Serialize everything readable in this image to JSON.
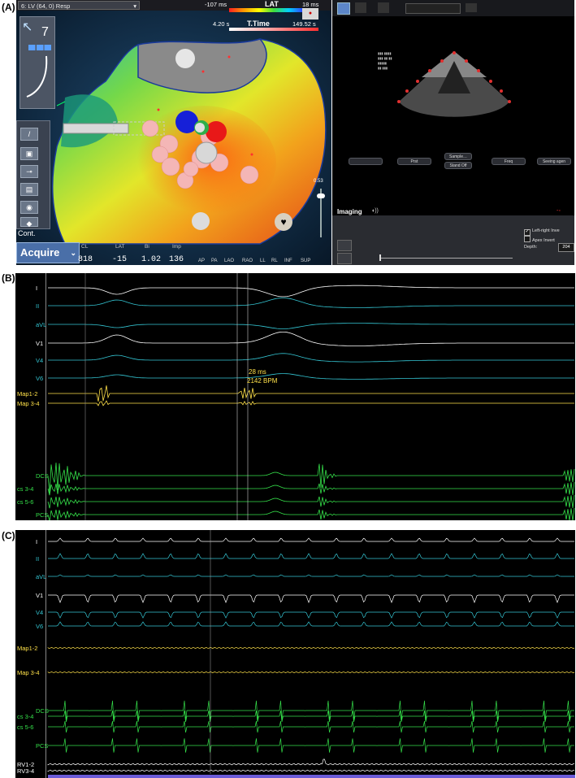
{
  "panels": {
    "a": "(A)",
    "b": "(B)",
    "c": "(C)"
  },
  "map": {
    "catheter_selector": "6: LV (64, 0) Resp",
    "lat_title": "LAT",
    "lat_min": "-107 ms",
    "lat_max": "18 ms",
    "tt_title": "T.Time",
    "tt_min": "4.20 s",
    "tt_max": "149.52 s",
    "tool_number": "7",
    "scale_value": "0.53",
    "cont_label": "Cont.",
    "acquire_label": "Acquire",
    "stat_labels": [
      "CL",
      "LAT",
      "Bi",
      "Imp"
    ],
    "stat_values": [
      "818",
      "-15",
      "1.02",
      "136"
    ],
    "view_buttons": [
      "AP",
      "PA",
      "LAO",
      "RAO",
      "LL",
      "RL",
      "INF",
      "SUP"
    ]
  },
  "imaging": {
    "title": "Imaging",
    "buttons": [
      "",
      "Prst",
      "Sample…",
      "Freq",
      "Seeing agen"
    ],
    "button_sub": "Stand Off",
    "options": [
      "Left-right Inve",
      "Apex Invert"
    ],
    "depth_label": "Depth:",
    "depth_value": "204"
  },
  "panel_b": {
    "leads": [
      "I",
      "II",
      "aVL",
      "V1",
      "V4",
      "V6",
      "Map1-2",
      "Map 3-4",
      "DCS",
      "cs 3-4",
      "cs 5-6",
      "PCS"
    ],
    "lead_colors": [
      "#ffffff",
      "#34c6d4",
      "#34c6d4",
      "#ffffff",
      "#34c6d4",
      "#34c6d4",
      "#ffe14a",
      "#ffe14a",
      "#35e04a",
      "#35e04a",
      "#35e04a",
      "#35e04a"
    ],
    "caliper_ms": "28 ms",
    "caliper_bpm": "2142 BPM"
  },
  "panel_c": {
    "leads": [
      "I",
      "II",
      "aVL",
      "V1",
      "V4",
      "V6",
      "Map1-2",
      "Map 3-4",
      "DCS",
      "cs 3-4",
      "cs 5-6",
      "PCS",
      "RV1-2",
      "RV3-4"
    ],
    "lead_colors": [
      "#ffffff",
      "#34c6d4",
      "#34c6d4",
      "#ffffff",
      "#34c6d4",
      "#34c6d4",
      "#ffe14a",
      "#ffe14a",
      "#35e04a",
      "#35e04a",
      "#35e04a",
      "#35e04a",
      "#ffffff",
      "#ffffff"
    ]
  }
}
